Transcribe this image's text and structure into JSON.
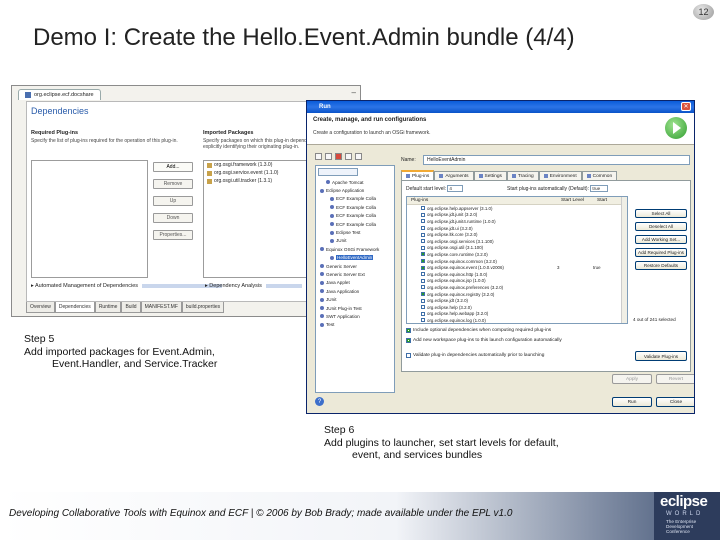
{
  "slide_number": "12",
  "title": "Demo I: Create the Hello.Event.Admin bundle (4/4)",
  "editor": {
    "tab_label": "org.eclipse.ecf.docshare",
    "heading": "Dependencies",
    "required_title": "Required Plug-ins",
    "required_desc": "Specify the list of plug-ins required for the operation of this plug-in.",
    "imported_title": "Imported Packages",
    "imported_desc": "Specify packages on which this plug-in depends without explicitly identifying their originating plug-in.",
    "imported_packages": [
      "org.osgi.framework (1.3.0)",
      "org.osgi.service.event (1.1.0)",
      "org.osgi.util.tracker (1.3.1)"
    ],
    "buttons": [
      "Add...",
      "Remove",
      "Up",
      "Down",
      "Properties..."
    ],
    "auto_mgmt": "Automated Management of Dependencies",
    "dep_analysis": "Dependency Analysis",
    "bottom_tabs": [
      "Overview",
      "Dependencies",
      "Runtime",
      "Build",
      "MANIFEST.MF",
      "build.properties"
    ]
  },
  "run_dialog": {
    "window_title": "Run",
    "banner_heading": "Create, manage, and run configurations",
    "banner_sub": "Create a configuration to launch an OSGi framework.",
    "name_label": "Name:",
    "name_value": "HelloEventAdmin",
    "tree_nodes": [
      "Apache Tomcat",
      "Eclipse Application",
      "ECF Example Colla",
      "ECF Example Colla",
      "ECF Example Colla",
      "ECF Example Colla",
      "Eclipse Test",
      "JUnit",
      "Equinox OSGi Framework",
      "HelloEventAdmin",
      "Generic Server",
      "Generic Server Ext",
      "Java Applet",
      "Java Application",
      "JUnit",
      "JUnit Plug-in Test",
      "SWT Application",
      "Test"
    ],
    "tabs": [
      "Plug-ins",
      "Arguments",
      "Settings",
      "Tracing",
      "Environment",
      "Common"
    ],
    "default_start_label": "Default start level:",
    "default_start_value": "4",
    "autostart_label": "Start plug-ins automatically (Default):",
    "autostart_value": "true",
    "columns": [
      "Plug-ins",
      "Start Level",
      "Start"
    ],
    "plugin_rows": [
      {
        "name": "org.eclipse.help.appserver (3.1.0)",
        "level": "",
        "start": ""
      },
      {
        "name": "org.eclipse.jdt.junit (3.2.0)",
        "level": "",
        "start": ""
      },
      {
        "name": "org.eclipse.jdt.junit4.runtime (1.0.0)",
        "level": "",
        "start": ""
      },
      {
        "name": "org.eclipse.jdt.ui (3.2.0)",
        "level": "",
        "start": ""
      },
      {
        "name": "org.eclipse.ltk.core (3.2.0)",
        "level": "",
        "start": ""
      },
      {
        "name": "org.eclipse.osgi.services (3.1.100)",
        "level": "",
        "start": ""
      },
      {
        "name": "org.eclipse.osgi.util (3.1.100)",
        "level": "",
        "start": ""
      },
      {
        "name": "org.eclipse.core.runtime (3.2.0)",
        "level": "",
        "start": ""
      },
      {
        "name": "org.eclipse.equinox.common (3.2.0)",
        "level": "",
        "start": ""
      },
      {
        "name": "org.eclipse.equinox.event (1.0.0.v2006)",
        "level": "3",
        "start": "true"
      },
      {
        "name": "org.eclipse.equinox.http (1.0.0)",
        "level": "",
        "start": ""
      },
      {
        "name": "org.eclipse.equinox.jsp (1.0.0)",
        "level": "",
        "start": ""
      },
      {
        "name": "org.eclipse.equinox.preferences (3.2.0)",
        "level": "",
        "start": ""
      },
      {
        "name": "org.eclipse.equinox.registry (3.2.0)",
        "level": "",
        "start": ""
      },
      {
        "name": "org.eclipse.jdt (3.2.0)",
        "level": "",
        "start": ""
      },
      {
        "name": "org.eclipse.help (3.2.0)",
        "level": "",
        "start": ""
      },
      {
        "name": "org.eclipse.help.webapp (3.2.0)",
        "level": "",
        "start": ""
      },
      {
        "name": "org.eclipse.equinox.log (1.0.0)",
        "level": "",
        "start": ""
      }
    ],
    "side_buttons": [
      "Select All",
      "Deselect All",
      "Add Working Set...",
      "Add Required Plug-ins",
      "Restore Defaults"
    ],
    "count_text": "4 out of 241 selected",
    "opt_include": "Include optional dependencies when computing required plug-ins",
    "opt_add_new": "Add new workspace plug-ins to this launch configuration automatically",
    "opt_validate": "Validate plug-in dependencies automatically prior to launching",
    "validate_button": "Validate Plug-ins",
    "apply_button": "Apply",
    "revert_button": "Revert",
    "run_button": "Run",
    "close_button": "Close"
  },
  "step5": {
    "line1": "Step 5",
    "line2": "Add imported packages for Event.Admin,",
    "line3": "Event.Handler, and Service.Tracker"
  },
  "step6": {
    "line1": "Step 6",
    "line2": "Add plugins to launcher, set start levels for default,",
    "line3": "event, and services bundles"
  },
  "footer": {
    "text": "Developing Collaborative Tools with Equinox and ECF | © 2006 by Bob Brady; made available under the EPL v1.0",
    "logo_word": "eclipse",
    "logo_sub": "WORLD",
    "logo_tag": "The Enterprise Development Conference"
  }
}
